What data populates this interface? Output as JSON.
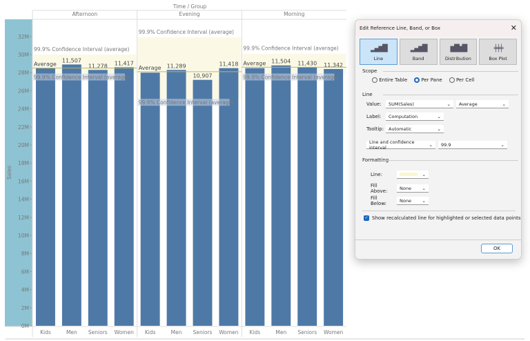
{
  "chart_data": {
    "type": "bar",
    "title": "Time / Group",
    "ylabel": "Sales",
    "ylim": [
      0,
      33
    ],
    "yticks": [
      "0M",
      "2M",
      "4M",
      "6M",
      "8M",
      "10M",
      "12M",
      "14M",
      "16M",
      "18M",
      "20M",
      "22M",
      "24M",
      "26M",
      "28M",
      "30M",
      "32M"
    ],
    "panes": [
      {
        "name": "Afternoon",
        "categories": [
          "Kids",
          "Men",
          "Seniors",
          "Women"
        ],
        "values_m": [
          28.5,
          28.9,
          28.3,
          28.6
        ],
        "labels": [
          "",
          "11,507",
          "11,278",
          "11,417"
        ],
        "average_m": 28.5,
        "ci_m": [
          27.9,
          30.0
        ],
        "ci_upper_label": "99.9% Confidence Interval (average)",
        "ci_lower_label": "99.9% Confidence Interval (average)",
        "avg_label": "Average"
      },
      {
        "name": "Evening",
        "categories": [
          "Kids",
          "Men",
          "Seniors",
          "Women"
        ],
        "values_m": [
          28.0,
          28.3,
          27.2,
          28.5
        ],
        "labels": [
          "",
          "11,289",
          "10,907",
          "11,418"
        ],
        "average_m": 28.1,
        "ci_m": [
          25.1,
          31.9
        ],
        "ci_upper_label": "99.9% Confidence Interval (average)",
        "ci_lower_label": "99.9% Confidence Interval (average)",
        "avg_label": "Average"
      },
      {
        "name": "Morning",
        "categories": [
          "Kids",
          "Men",
          "Seniors",
          "Women"
        ],
        "values_m": [
          28.5,
          28.8,
          28.6,
          28.4
        ],
        "labels": [
          "",
          "11,504",
          "11,430",
          "11,342"
        ],
        "average_m": 28.6,
        "ci_m": [
          27.9,
          30.1
        ],
        "ci_upper_label": "99.9% Confidence Interval (average)",
        "ci_lower_label": "99.9% Confidence Interval (average)",
        "avg_label": "Average"
      }
    ],
    "colors": {
      "bar": "#4e79a7",
      "band": "#fbf9e6",
      "line": "#b9b96a",
      "axis_bg": "#8ec3d3"
    }
  },
  "dialog": {
    "title": "Edit Reference Line, Band, or Box",
    "types": [
      {
        "label": "Line",
        "selected": true
      },
      {
        "label": "Band"
      },
      {
        "label": "Distribution"
      },
      {
        "label": "Box Plot"
      }
    ],
    "scope": {
      "heading": "Scope",
      "options": [
        "Entire Table",
        "Per Pane",
        "Per Cell"
      ],
      "selected": "Per Pane"
    },
    "line": {
      "heading": "Line",
      "value_label": "Value:",
      "value": "SUM(Sales)",
      "aggregation": "Average",
      "label_label": "Label:",
      "label": "Computation",
      "tooltip_label": "Tooltip:",
      "tooltip": "Automatic",
      "interval_type": "Line and confidence interval",
      "interval_value": "99.9"
    },
    "formatting": {
      "heading": "Formatting",
      "line_label": "Line:",
      "fill_above_label": "Fill Above:",
      "fill_above": "None",
      "fill_below_label": "Fill Below:",
      "fill_below": "None"
    },
    "recalc_label": "Show recalculated line for highlighted or selected data points",
    "recalc_checked": true,
    "ok": "OK"
  }
}
